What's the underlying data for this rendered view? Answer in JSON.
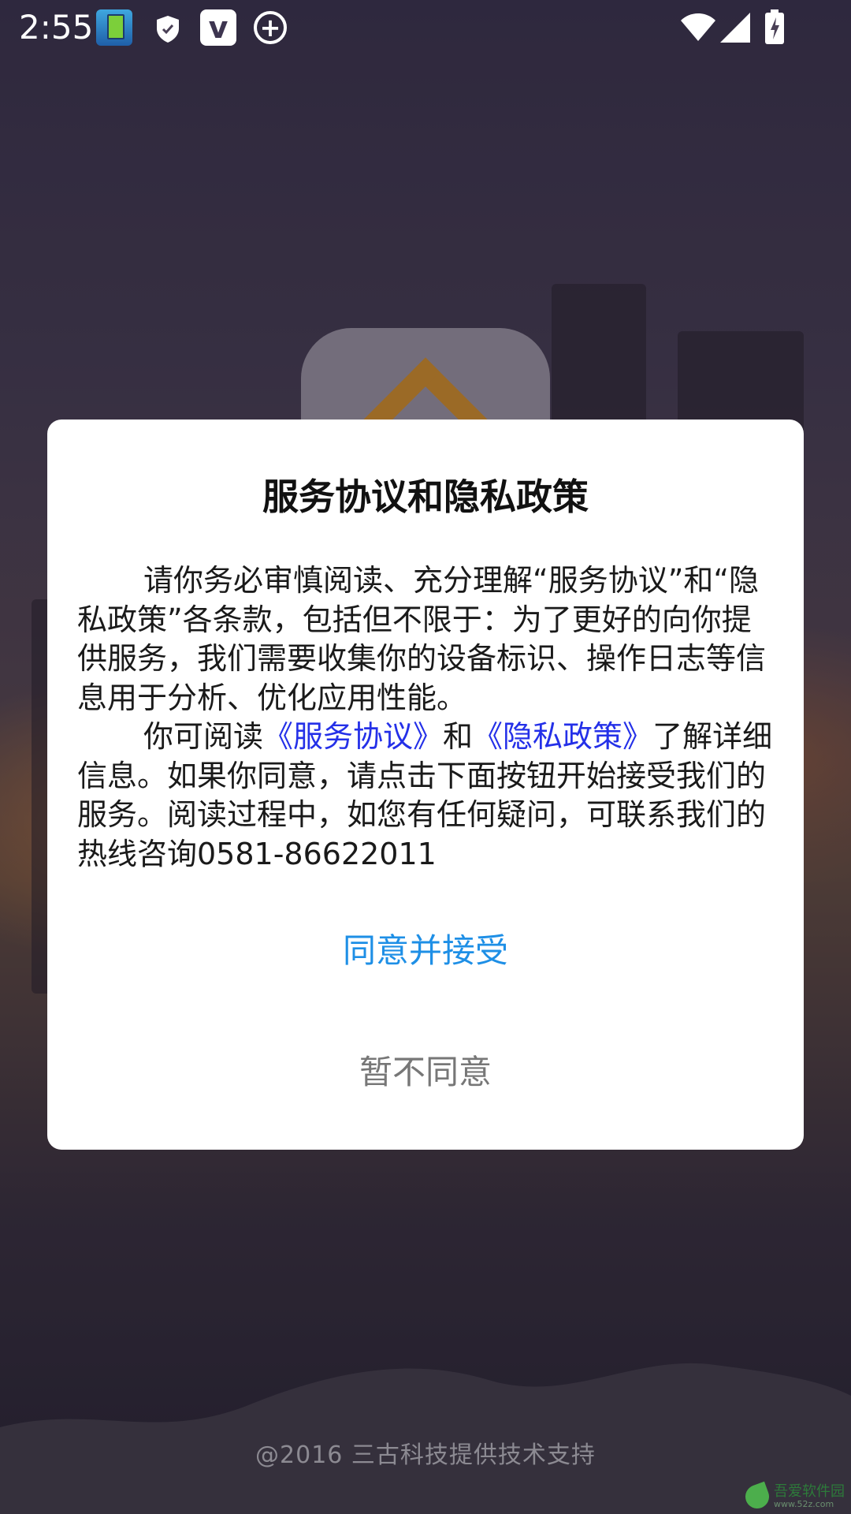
{
  "status_bar": {
    "time": "2:55",
    "icons": [
      "battery-app-icon",
      "shield-icon",
      "v-icon",
      "plus-circle-icon",
      "wifi-icon",
      "signal-icon",
      "battery-charging-icon"
    ]
  },
  "dialog": {
    "title": "服务协议和隐私政策",
    "paragraph1": "请你务必审慎阅读、充分理解“服务协议”和“隐私政策”各条款，包括但不限于：为了更好的向你提供服务，我们需要收集你的设备标识、操作日志等信息用于分析、优化应用性能。",
    "paragraph2_prefix": "你可阅读",
    "service_link": "《服务协议》",
    "and_text": "和",
    "privacy_link": "《隐私政策》",
    "paragraph2_suffix": "了解详细信息。如果你同意，请点击下面按钮开始接受我们的服务。阅读过程中，如您有任何疑问，可联系我们的热线咨询0581-86622011",
    "agree_label": "同意并接受",
    "disagree_label": "暂不同意"
  },
  "footer": {
    "support_text": "@2016   三古科技提供技术支持"
  },
  "watermark": {
    "name": "吾爱软件园",
    "site": "www.52z.com"
  },
  "colors": {
    "link": "#2430e8",
    "agree": "#1e8fe6",
    "disagree": "#777777",
    "logo_roof": "#e39a2c"
  }
}
